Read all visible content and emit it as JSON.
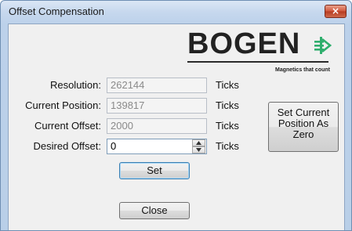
{
  "window": {
    "title": "Offset Compensation",
    "close_glyph": "×"
  },
  "logo": {
    "brand": "BOGEN",
    "tagline": "Magnetics that count",
    "color_accent": "#2fae6d",
    "icon": "bogen-logo-mark-icon"
  },
  "form": {
    "resolution": {
      "label": "Resolution:",
      "value": "262144",
      "unit": "Ticks"
    },
    "current_position": {
      "label": "Current Position:",
      "value": "139817",
      "unit": "Ticks"
    },
    "current_offset": {
      "label": "Current Offset:",
      "value": "2000",
      "unit": "Ticks"
    },
    "desired_offset": {
      "label": "Desired Offset:",
      "value": "0",
      "unit": "Ticks"
    }
  },
  "buttons": {
    "set_label": "Set",
    "close_label": "Close",
    "set_zero_label": "Set Current Position As Zero"
  }
}
